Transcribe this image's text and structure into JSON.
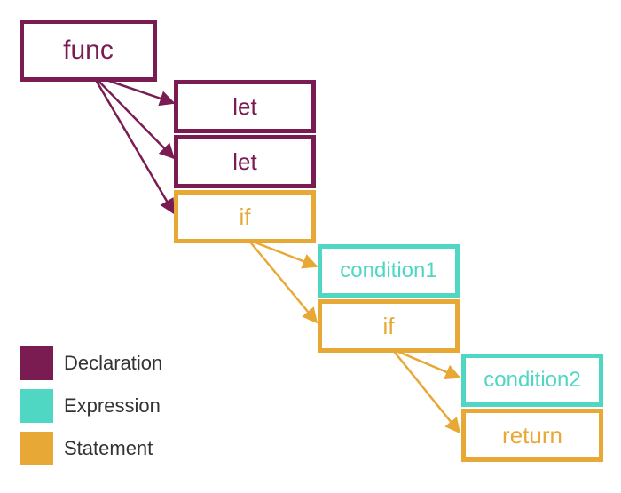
{
  "nodes": {
    "func": "func",
    "let1": "let",
    "let2": "let",
    "if1": "if",
    "cond1": "condition1",
    "if2": "if",
    "cond2": "condition2",
    "return": "return"
  },
  "legend": {
    "declaration": "Declaration",
    "expression": "Expression",
    "statement": "Statement"
  },
  "colors": {
    "declaration": "#7a1b52",
    "expression": "#4fd7c4",
    "statement": "#e8a836"
  },
  "chart_data": {
    "type": "tree",
    "title": "",
    "legend": [
      {
        "name": "Declaration",
        "color": "#7a1b52"
      },
      {
        "name": "Expression",
        "color": "#4fd7c4"
      },
      {
        "name": "Statement",
        "color": "#e8a836"
      }
    ],
    "nodes": [
      {
        "id": "func",
        "label": "func",
        "kind": "Declaration"
      },
      {
        "id": "let1",
        "label": "let",
        "kind": "Declaration"
      },
      {
        "id": "let2",
        "label": "let",
        "kind": "Declaration"
      },
      {
        "id": "if1",
        "label": "if",
        "kind": "Statement"
      },
      {
        "id": "cond1",
        "label": "condition1",
        "kind": "Expression"
      },
      {
        "id": "if2",
        "label": "if",
        "kind": "Statement"
      },
      {
        "id": "cond2",
        "label": "condition2",
        "kind": "Expression"
      },
      {
        "id": "return",
        "label": "return",
        "kind": "Statement"
      }
    ],
    "edges": [
      {
        "from": "func",
        "to": "let1"
      },
      {
        "from": "func",
        "to": "let2"
      },
      {
        "from": "func",
        "to": "if1"
      },
      {
        "from": "if1",
        "to": "cond1"
      },
      {
        "from": "if1",
        "to": "if2"
      },
      {
        "from": "if2",
        "to": "cond2"
      },
      {
        "from": "if2",
        "to": "return"
      }
    ]
  }
}
